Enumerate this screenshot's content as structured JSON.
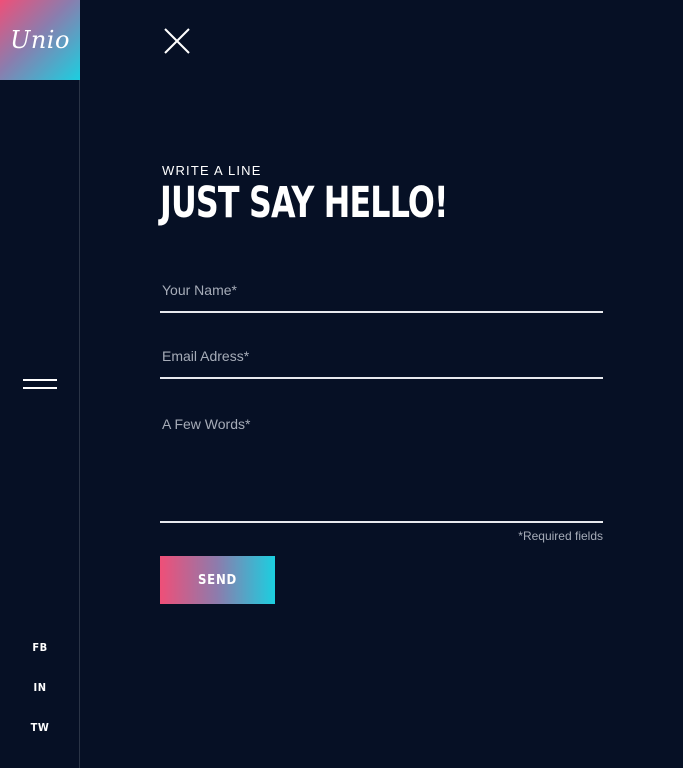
{
  "sidebar": {
    "logo_text": "Unio",
    "menu_icon": "hamburger-menu-icon",
    "social_links": [
      "FB",
      "IN",
      "TW"
    ]
  },
  "header": {
    "close_icon": "close-icon"
  },
  "contact": {
    "eyebrow": "WRITE A LINE",
    "headline": "JUST SAY HELLO!",
    "fields": {
      "name_placeholder": "Your Name*",
      "email_placeholder": "Email Adress*",
      "message_placeholder": "A Few Words*"
    },
    "required_note": "*Required fields",
    "send_label": "SEND"
  },
  "colors": {
    "background": "#061025",
    "gradient_start": "#ef4f78",
    "gradient_end": "#1bcfe0",
    "text": "#ffffff",
    "muted_text": "#a6acb8"
  }
}
